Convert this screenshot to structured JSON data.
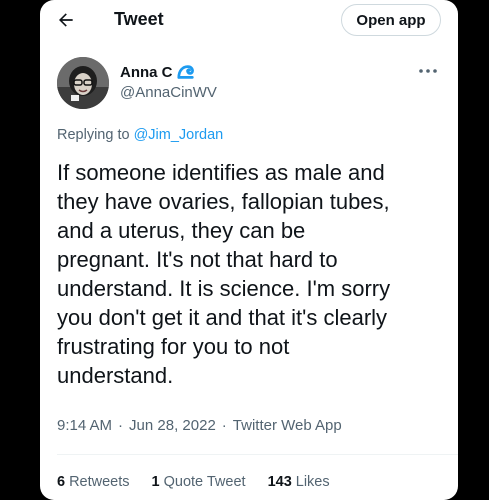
{
  "header": {
    "title": "Tweet",
    "open_app_label": "Open app",
    "back_icon": "arrow-left-icon"
  },
  "author": {
    "name": "Anna C",
    "badge_icon": "wave-emoji-icon",
    "handle": "@AnnaCinWV"
  },
  "reply": {
    "prefix": "Replying to",
    "target": "@Jim_Jordan"
  },
  "tweet": {
    "text": "If someone identifies as male and\nthey have ovaries, fallopian tubes,\nand a uterus, they can be\npregnant. It's not that hard to\nunderstand. It is science. I'm sorry\nyou don't get it and that it's clearly\nfrustrating for you to not\nunderstand."
  },
  "meta": {
    "time": "9:14 AM",
    "separator": "·",
    "date": "Jun 28, 2022",
    "source": "Twitter Web App"
  },
  "stats": {
    "retweets_count": "6",
    "retweets_label": "Retweets",
    "quotes_count": "1",
    "quotes_label": "Quote Tweet",
    "likes_count": "143",
    "likes_label": "Likes"
  },
  "colors": {
    "accent": "#1d9bf0",
    "text_primary": "#0f1419",
    "text_secondary": "#536471",
    "background": "#000000",
    "card": "#ffffff"
  }
}
